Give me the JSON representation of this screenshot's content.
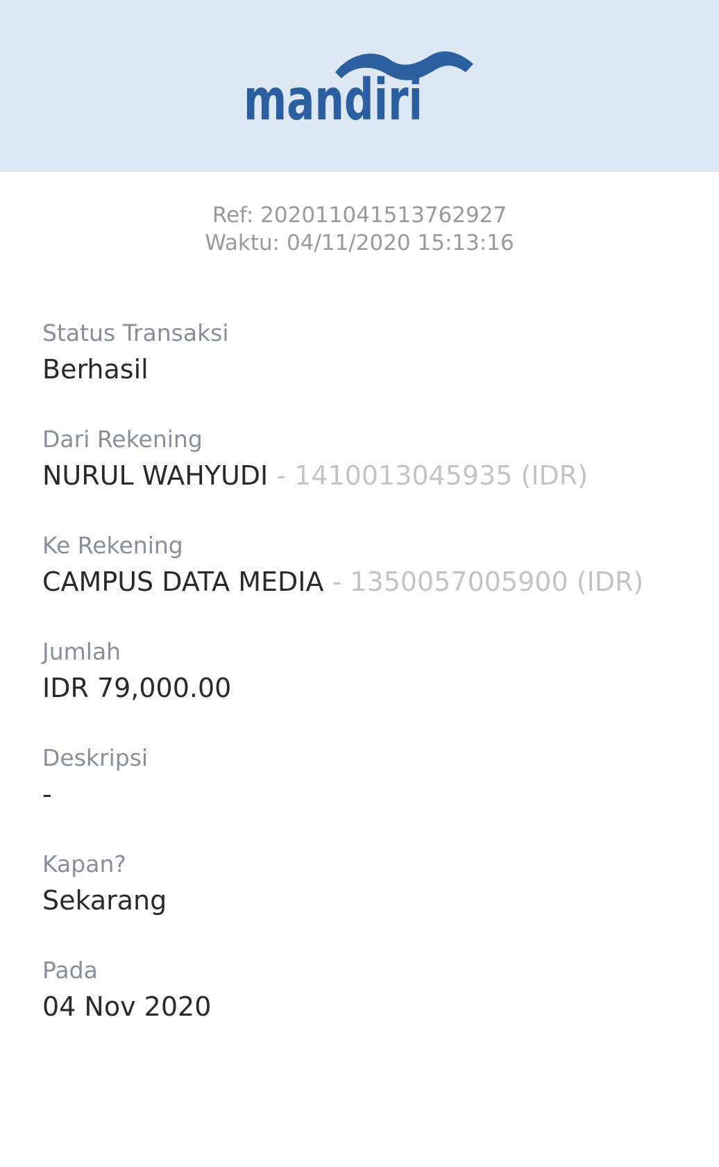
{
  "header": {
    "logo_text": "mandiri",
    "brand_color": "#2b5fa0",
    "background_color": "#dce8f4",
    "logo_icon": "mandiri-wave-icon"
  },
  "meta": {
    "ref": "Ref: 202011041513762927",
    "time": "Waktu: 04/11/2020 15:13:16"
  },
  "fields": {
    "status": {
      "label": "Status Transaksi",
      "value": "Berhasil"
    },
    "from": {
      "label": "Dari Rekening",
      "name": "NURUL WAHYUDI",
      "account": " - 1410013045935 (IDR)"
    },
    "to": {
      "label": "Ke Rekening",
      "name": "CAMPUS DATA MEDIA",
      "account": " - 1350057005900 (IDR)"
    },
    "amount": {
      "label": "Jumlah",
      "value": "IDR 79,000.00"
    },
    "description": {
      "label": "Deskripsi",
      "value": "-"
    },
    "when": {
      "label": "Kapan?",
      "value": "Sekarang"
    },
    "date": {
      "label": "Pada",
      "value": "04 Nov 2020"
    }
  }
}
